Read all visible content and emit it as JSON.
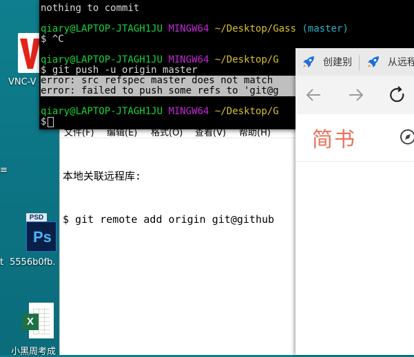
{
  "desktop": {
    "icons": [
      {
        "label": "VNC-V"
      },
      {
        "label": "5556b0fb."
      },
      {
        "label": "小黑周考成"
      }
    ],
    "psd_tab_text": "PSD",
    "psd_body_text": "Ps",
    "xls_badge_text": "X",
    "sliver_top": "≡",
    "sliver_bottom": "t"
  },
  "terminal": {
    "lines": {
      "l0": {
        "text": "nothing to commit"
      },
      "l2": {
        "user": "qiary@LAPTOP-JTAGH1JU",
        "shell": "MINGW64",
        "path": "~/Desktop/Gass",
        "branch": "(master)"
      },
      "l3": {
        "text": "$ ^C"
      },
      "l5": {
        "user": "qiary@LAPTOP-JTAGH1JU",
        "shell": "MINGW64",
        "path": "~/Desktop/G"
      },
      "l6": {
        "text": "$ git push -u origin master"
      },
      "l7": {
        "text": "error: src refspec master does not match"
      },
      "l8": {
        "text": "error: failed to push some refs to 'git@g"
      },
      "l10": {
        "user": "qiary@LAPTOP-JTAGH1JU",
        "shell": "MINGW64",
        "path": "~/Desktop/G"
      },
      "l11": {
        "text": "$"
      }
    }
  },
  "notepad": {
    "menu": [
      "文件(F)",
      "编辑(E)",
      "格式(O)",
      "查看(V)",
      "帮助(H)"
    ],
    "lines": [
      "本地关联远程库:",
      "$ git remote add origin git@github"
    ]
  },
  "browser": {
    "tabs": [
      {
        "label": "创建别"
      },
      {
        "label": "从远程"
      }
    ],
    "site_logo": "简书"
  },
  "colors": {
    "prompt_user": "#19d33c",
    "prompt_shell": "#c22ad6",
    "prompt_path": "#d8c12a",
    "prompt_branch": "#2ab3c8",
    "jianshu_brand": "#ea6f5a",
    "tab_icon": "#1e6fd9"
  }
}
